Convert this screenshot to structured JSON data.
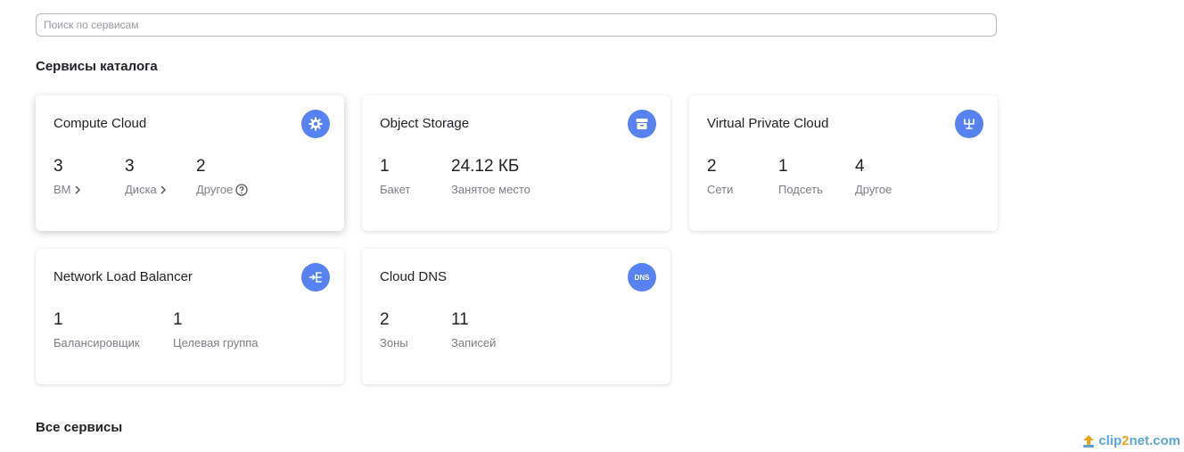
{
  "search": {
    "placeholder": "Поиск по сервисам"
  },
  "catalog_title": "Сервисы каталога",
  "all_services_title": "Все сервисы",
  "accent_color": "#5682f2",
  "cards": [
    {
      "title": "Compute Cloud",
      "icon": "gear-icon",
      "metrics": [
        {
          "value": "3",
          "label": "ВМ",
          "suffix_icon": "chevron-right-icon"
        },
        {
          "value": "3",
          "label": "Диска",
          "suffix_icon": "chevron-right-icon"
        },
        {
          "value": "2",
          "label": "Другое",
          "suffix_icon": "help-circle-icon"
        }
      ]
    },
    {
      "title": "Object Storage",
      "icon": "storage-icon",
      "metrics": [
        {
          "value": "1",
          "label": "Бакет"
        },
        {
          "value": "24.12 КБ",
          "label": "Занятое место"
        }
      ]
    },
    {
      "title": "Virtual Private Cloud",
      "icon": "network-icon",
      "metrics": [
        {
          "value": "2",
          "label": "Сети"
        },
        {
          "value": "1",
          "label": "Подсеть"
        },
        {
          "value": "4",
          "label": "Другое"
        }
      ]
    },
    {
      "title": "Network Load Balancer",
      "icon": "load-balancer-icon",
      "metrics": [
        {
          "value": "1",
          "label": "Балансировщик"
        },
        {
          "value": "1",
          "label": "Целевая группа"
        }
      ]
    },
    {
      "title": "Cloud DNS",
      "icon": "dns-icon",
      "icon_text": "DNS",
      "metrics": [
        {
          "value": "2",
          "label": "Зоны"
        },
        {
          "value": "11",
          "label": "Записей"
        }
      ]
    }
  ],
  "watermark": {
    "part1": "clip",
    "part2": "2",
    "part3": "net.com",
    "icon": "clip2net-logo-icon"
  }
}
